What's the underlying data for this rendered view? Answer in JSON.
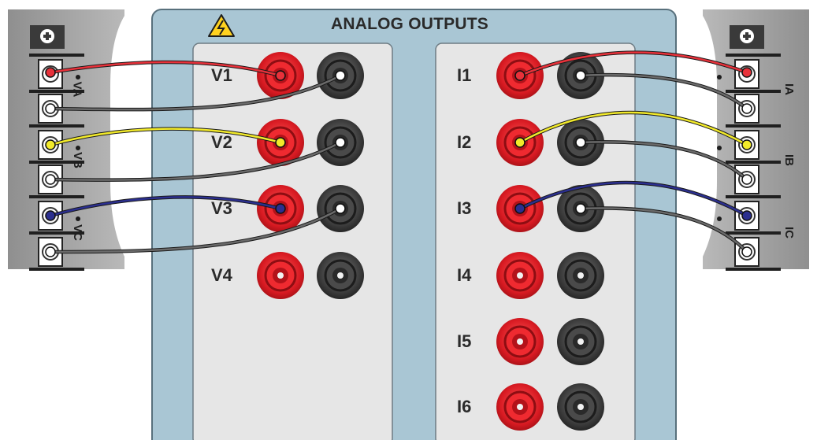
{
  "panel": {
    "title": "ANALOG OUTPUTS",
    "warning_icon": "high-voltage-warning-icon"
  },
  "voltage_channels": [
    "V1",
    "V2",
    "V3",
    "V4"
  ],
  "current_channels": [
    "I1",
    "I2",
    "I3",
    "I4",
    "I5",
    "I6"
  ],
  "left_terminal_block": {
    "header_icon": "plus-circle-icon",
    "groups": [
      "VA",
      "VB",
      "VC"
    ]
  },
  "right_terminal_block": {
    "header_icon": "plus-circle-icon",
    "groups": [
      "IA",
      "IB",
      "IC"
    ]
  },
  "colors": {
    "phase_a": "#e8313a",
    "phase_b": "#f2ea2a",
    "phase_c": "#2b2f8f",
    "neutral": "#6a6a6a",
    "panel_bg": "#a9c6d4",
    "socket_red": "#e01f26",
    "socket_black": "#3a3a3a"
  }
}
